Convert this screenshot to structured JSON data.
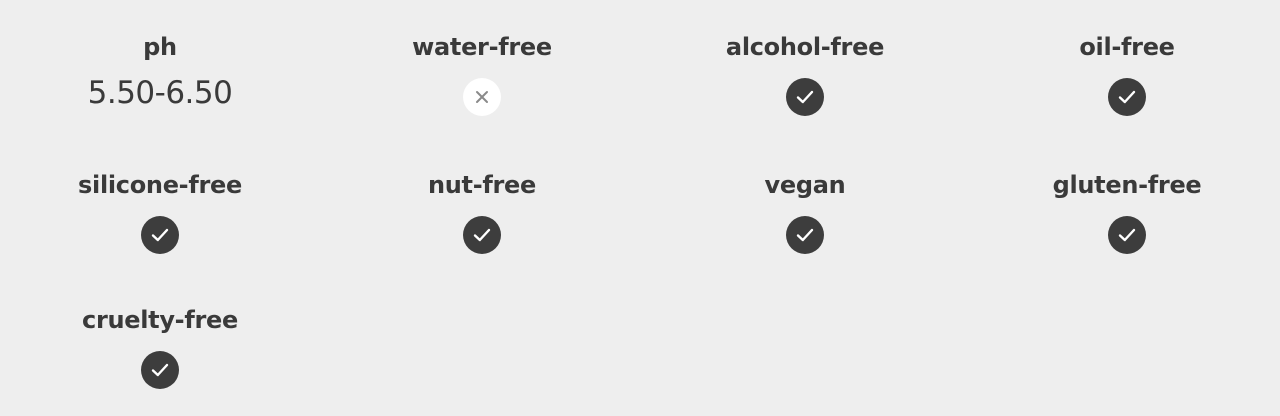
{
  "attributes": [
    {
      "label": "ph",
      "value": "5.50-6.50",
      "status": null
    },
    {
      "label": "water-free",
      "value": null,
      "status": "cross",
      "icon": "x-icon"
    },
    {
      "label": "alcohol-free",
      "value": null,
      "status": "check",
      "icon": "checkmark-icon"
    },
    {
      "label": "oil-free",
      "value": null,
      "status": "check",
      "icon": "checkmark-icon"
    },
    {
      "label": "silicone-free",
      "value": null,
      "status": "check",
      "icon": "checkmark-icon"
    },
    {
      "label": "nut-free",
      "value": null,
      "status": "check",
      "icon": "checkmark-icon"
    },
    {
      "label": "vegan",
      "value": null,
      "status": "check",
      "icon": "checkmark-icon"
    },
    {
      "label": "gluten-free",
      "value": null,
      "status": "check",
      "icon": "checkmark-icon"
    },
    {
      "label": "cruelty-free",
      "value": null,
      "status": "check",
      "icon": "checkmark-icon"
    }
  ],
  "colors": {
    "background": "#eeeeee",
    "text": "#3a3a3a",
    "check_fill": "#3d3d3d",
    "cross_fill": "#ffffff",
    "cross_stroke": "#8a8a8a"
  }
}
